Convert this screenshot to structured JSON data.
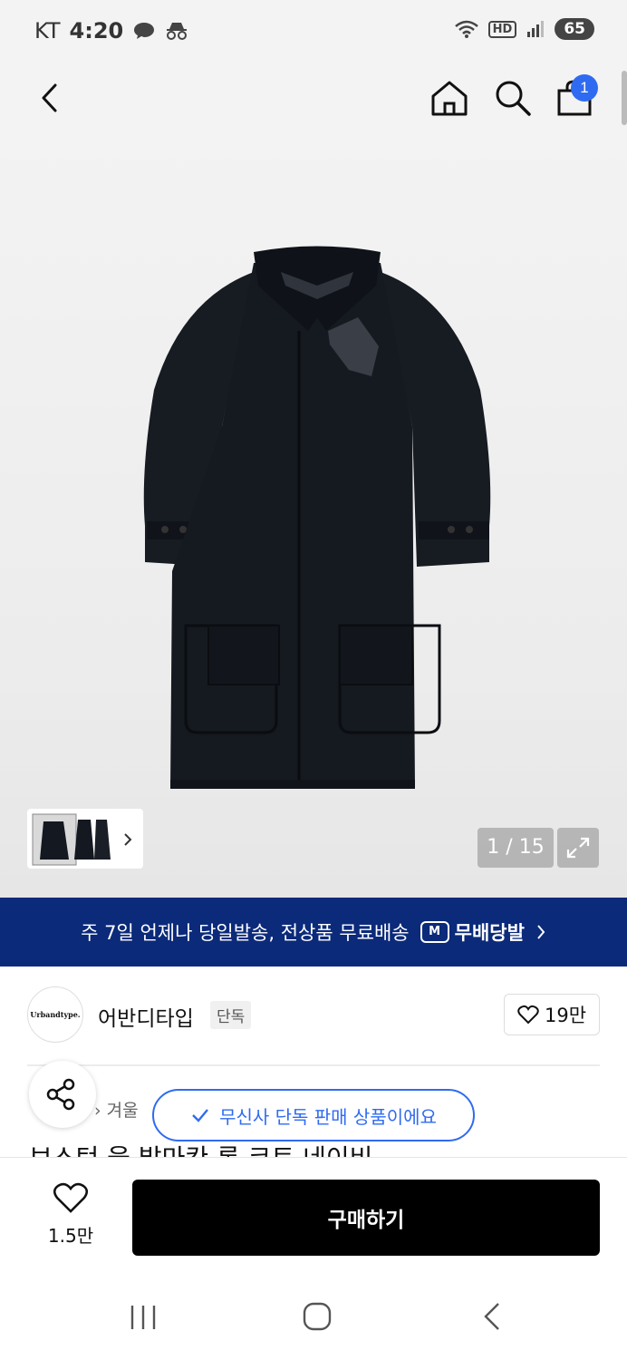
{
  "status_bar": {
    "carrier": "KT",
    "time": "4:20",
    "hd": "HD",
    "battery": "65"
  },
  "header": {
    "cart_count": "1"
  },
  "gallery": {
    "counter": "1 / 15"
  },
  "banner": {
    "text": "주 7일 언제나 당일발송, 전상품 무료배송",
    "brand_mark": "M",
    "brand": "무배당발"
  },
  "brand": {
    "logo_text": "Urbandtype.",
    "name": "어반디타입",
    "exclusive_tag": "단독",
    "likes": "19만"
  },
  "breadcrumb": {
    "text": "› 겨울"
  },
  "toast": {
    "text": "무신사 단독 판매 상품이에요"
  },
  "product": {
    "title_partial": "보스턴 울 발마칸 롱 코트 네이비"
  },
  "bottom_bar": {
    "wish_count": "1.5만",
    "buy_label": "구매하기"
  },
  "colors": {
    "banner_bg": "#0b2a7a",
    "accent": "#2f6bf0",
    "buy_bg": "#000000"
  }
}
